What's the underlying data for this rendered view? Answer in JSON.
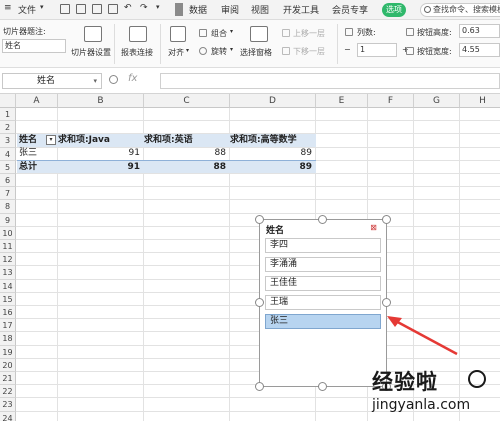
{
  "menubar": {
    "file_label": "文件",
    "tabs": [
      "数据",
      "审阅",
      "视图",
      "开发工具",
      "会员专享"
    ],
    "active_tab": "选项",
    "search_placeholder": "查找命令、搜索模板"
  },
  "ribbon": {
    "slicer_caption_label": "切片器题注:",
    "slicer_caption_value": "姓名",
    "slicer_settings": "切片器设置",
    "report_connections": "报表连接",
    "align": "对齐",
    "group": "组合",
    "rotate": "旋转",
    "selection_pane": "选择窗格",
    "bring_forward": "上移一层",
    "send_backward": "下移一层",
    "columns_label": "列数:",
    "columns_value": "1",
    "button_height_label": "按钮高度:",
    "button_height_value": "0.63",
    "button_width_label": "按钮宽度:",
    "button_width_value": "4.55"
  },
  "namebox": {
    "value": "姓名",
    "fx": "fx"
  },
  "columns": [
    "A",
    "B",
    "C",
    "D",
    "E",
    "F",
    "G",
    "H"
  ],
  "rows": [
    "1",
    "2",
    "3",
    "4",
    "5",
    "6",
    "7",
    "8",
    "9",
    "10",
    "11",
    "12",
    "13",
    "14",
    "15",
    "16",
    "17",
    "18",
    "19",
    "20",
    "21",
    "22",
    "23",
    "24"
  ],
  "pivot": {
    "row_header": "姓名",
    "col_java": "求和项:Java",
    "col_english": "求和项:英语",
    "col_math": "求和项:高等数学",
    "rows": [
      {
        "name": "张三",
        "java": "91",
        "english": "88",
        "math": "89"
      }
    ],
    "total_label": "总计",
    "total": {
      "java": "91",
      "english": "88",
      "math": "89"
    }
  },
  "slicer": {
    "title": "姓名",
    "items": [
      "李四",
      "李涌涌",
      "王佳佳",
      "王瑞",
      "张三"
    ],
    "selected": "张三"
  },
  "watermark": {
    "cn": "经验啦",
    "en": "jingyanla.com"
  }
}
